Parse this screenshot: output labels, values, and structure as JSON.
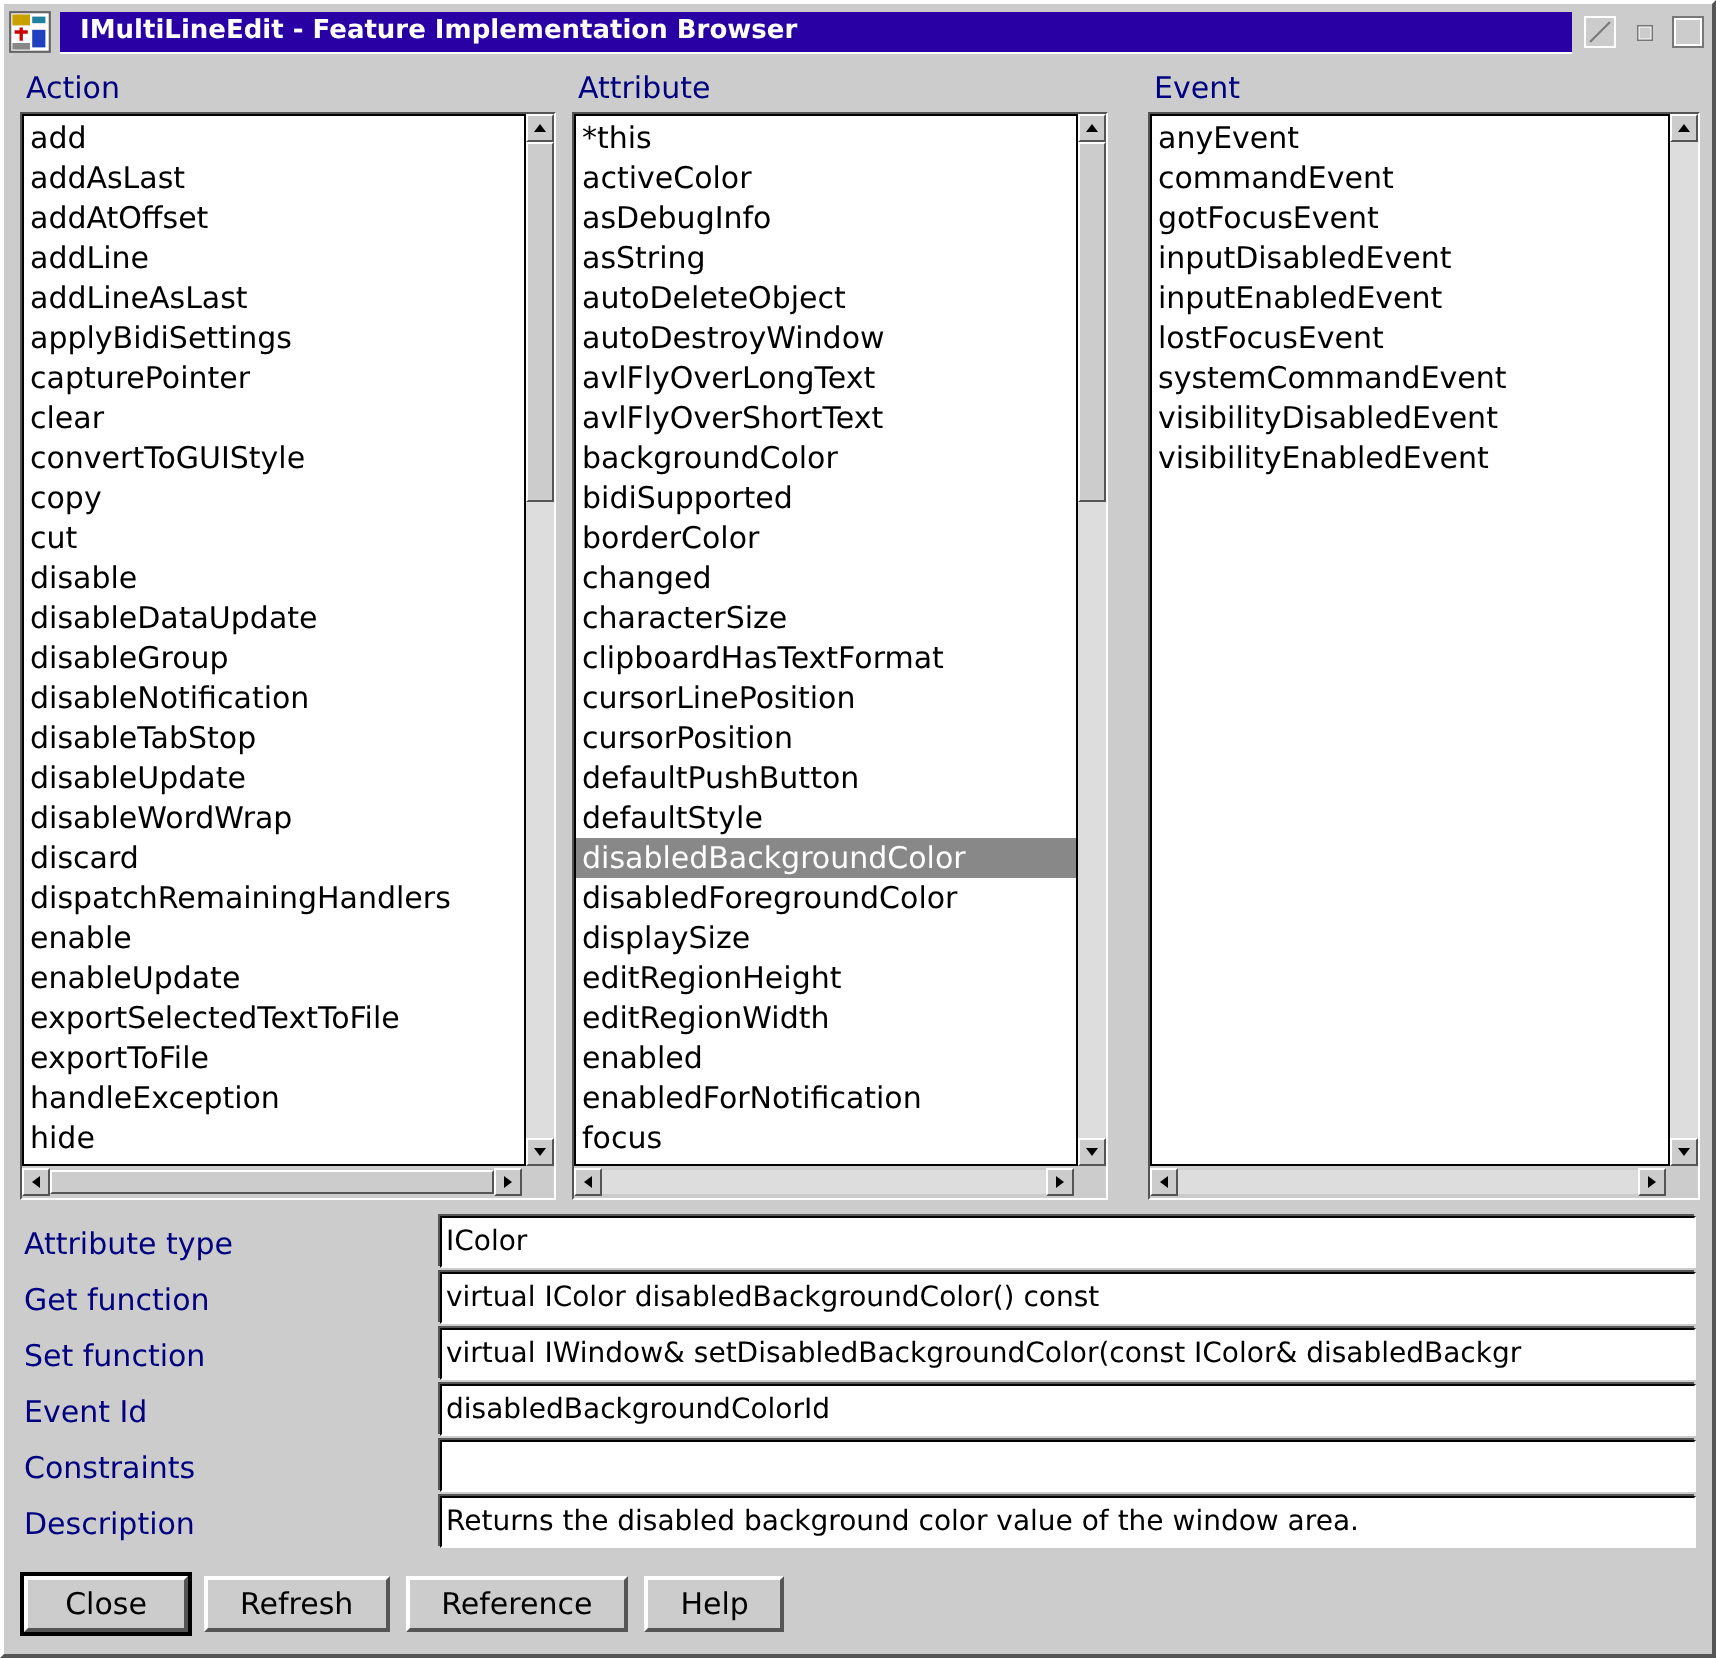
{
  "window": {
    "title": "IMultiLineEdit  - Feature Implementation Browser"
  },
  "lists": [
    {
      "heading": "Action",
      "items": [
        {
          "label": "add",
          "selected": false
        },
        {
          "label": "addAsLast",
          "selected": false
        },
        {
          "label": "addAtOffset",
          "selected": false
        },
        {
          "label": "addLine",
          "selected": false
        },
        {
          "label": "addLineAsLast",
          "selected": false
        },
        {
          "label": "applyBidiSettings",
          "selected": false
        },
        {
          "label": "capturePointer",
          "selected": false
        },
        {
          "label": "clear",
          "selected": false
        },
        {
          "label": "convertToGUIStyle",
          "selected": false
        },
        {
          "label": "copy",
          "selected": false
        },
        {
          "label": "cut",
          "selected": false
        },
        {
          "label": "disable",
          "selected": false
        },
        {
          "label": "disableDataUpdate",
          "selected": false
        },
        {
          "label": "disableGroup",
          "selected": false
        },
        {
          "label": "disableNotification",
          "selected": false
        },
        {
          "label": "disableTabStop",
          "selected": false
        },
        {
          "label": "disableUpdate",
          "selected": false
        },
        {
          "label": "disableWordWrap",
          "selected": false
        },
        {
          "label": "discard",
          "selected": false
        },
        {
          "label": "dispatchRemainingHandlers",
          "selected": false
        },
        {
          "label": "enable",
          "selected": false
        },
        {
          "label": "enableUpdate",
          "selected": false
        },
        {
          "label": "exportSelectedTextToFile",
          "selected": false
        },
        {
          "label": "exportToFile",
          "selected": false
        },
        {
          "label": "handleException",
          "selected": false
        },
        {
          "label": "hide",
          "selected": false
        }
      ]
    },
    {
      "heading": "Attribute",
      "items": [
        {
          "label": "*this",
          "selected": false
        },
        {
          "label": "activeColor",
          "selected": false
        },
        {
          "label": "asDebugInfo",
          "selected": false
        },
        {
          "label": "asString",
          "selected": false
        },
        {
          "label": "autoDeleteObject",
          "selected": false
        },
        {
          "label": "autoDestroyWindow",
          "selected": false
        },
        {
          "label": "avlFlyOverLongText",
          "selected": false
        },
        {
          "label": "avlFlyOverShortText",
          "selected": false
        },
        {
          "label": "backgroundColor",
          "selected": false
        },
        {
          "label": "bidiSupported",
          "selected": false
        },
        {
          "label": "borderColor",
          "selected": false
        },
        {
          "label": "changed",
          "selected": false
        },
        {
          "label": "characterSize",
          "selected": false
        },
        {
          "label": "clipboardHasTextFormat",
          "selected": false
        },
        {
          "label": "cursorLinePosition",
          "selected": false
        },
        {
          "label": "cursorPosition",
          "selected": false
        },
        {
          "label": "defaultPushButton",
          "selected": false
        },
        {
          "label": "defaultStyle",
          "selected": false
        },
        {
          "label": "disabledBackgroundColor",
          "selected": true
        },
        {
          "label": "disabledForegroundColor",
          "selected": false
        },
        {
          "label": "displaySize",
          "selected": false
        },
        {
          "label": "editRegionHeight",
          "selected": false
        },
        {
          "label": "editRegionWidth",
          "selected": false
        },
        {
          "label": "enabled",
          "selected": false
        },
        {
          "label": "enabledForNotification",
          "selected": false
        },
        {
          "label": "focus",
          "selected": false
        }
      ]
    },
    {
      "heading": "Event",
      "items": [
        {
          "label": "anyEvent",
          "selected": false
        },
        {
          "label": "commandEvent",
          "selected": false
        },
        {
          "label": "gotFocusEvent",
          "selected": false
        },
        {
          "label": "inputDisabledEvent",
          "selected": false
        },
        {
          "label": "inputEnabledEvent",
          "selected": false
        },
        {
          "label": "lostFocusEvent",
          "selected": false
        },
        {
          "label": "systemCommandEvent",
          "selected": false
        },
        {
          "label": "visibilityDisabledEvent",
          "selected": false
        },
        {
          "label": "visibilityEnabledEvent",
          "selected": false
        }
      ]
    }
  ],
  "details": [
    {
      "label": "Attribute type",
      "value": "IColor"
    },
    {
      "label": "Get function",
      "value": "virtual IColor disabledBackgroundColor() const"
    },
    {
      "label": "Set function",
      "value": "virtual IWindow& setDisabledBackgroundColor(const IColor& disabledBackgr"
    },
    {
      "label": "Event Id",
      "value": "disabledBackgroundColorId"
    },
    {
      "label": "Constraints"
    },
    {
      "label": "Description",
      "value": "Returns the disabled background color value of the window area."
    }
  ],
  "buttons": [
    {
      "label": "Close",
      "default": true
    },
    {
      "label": "Refresh",
      "default": false
    },
    {
      "label": "Reference",
      "default": false
    },
    {
      "label": "Help",
      "default": false
    }
  ]
}
